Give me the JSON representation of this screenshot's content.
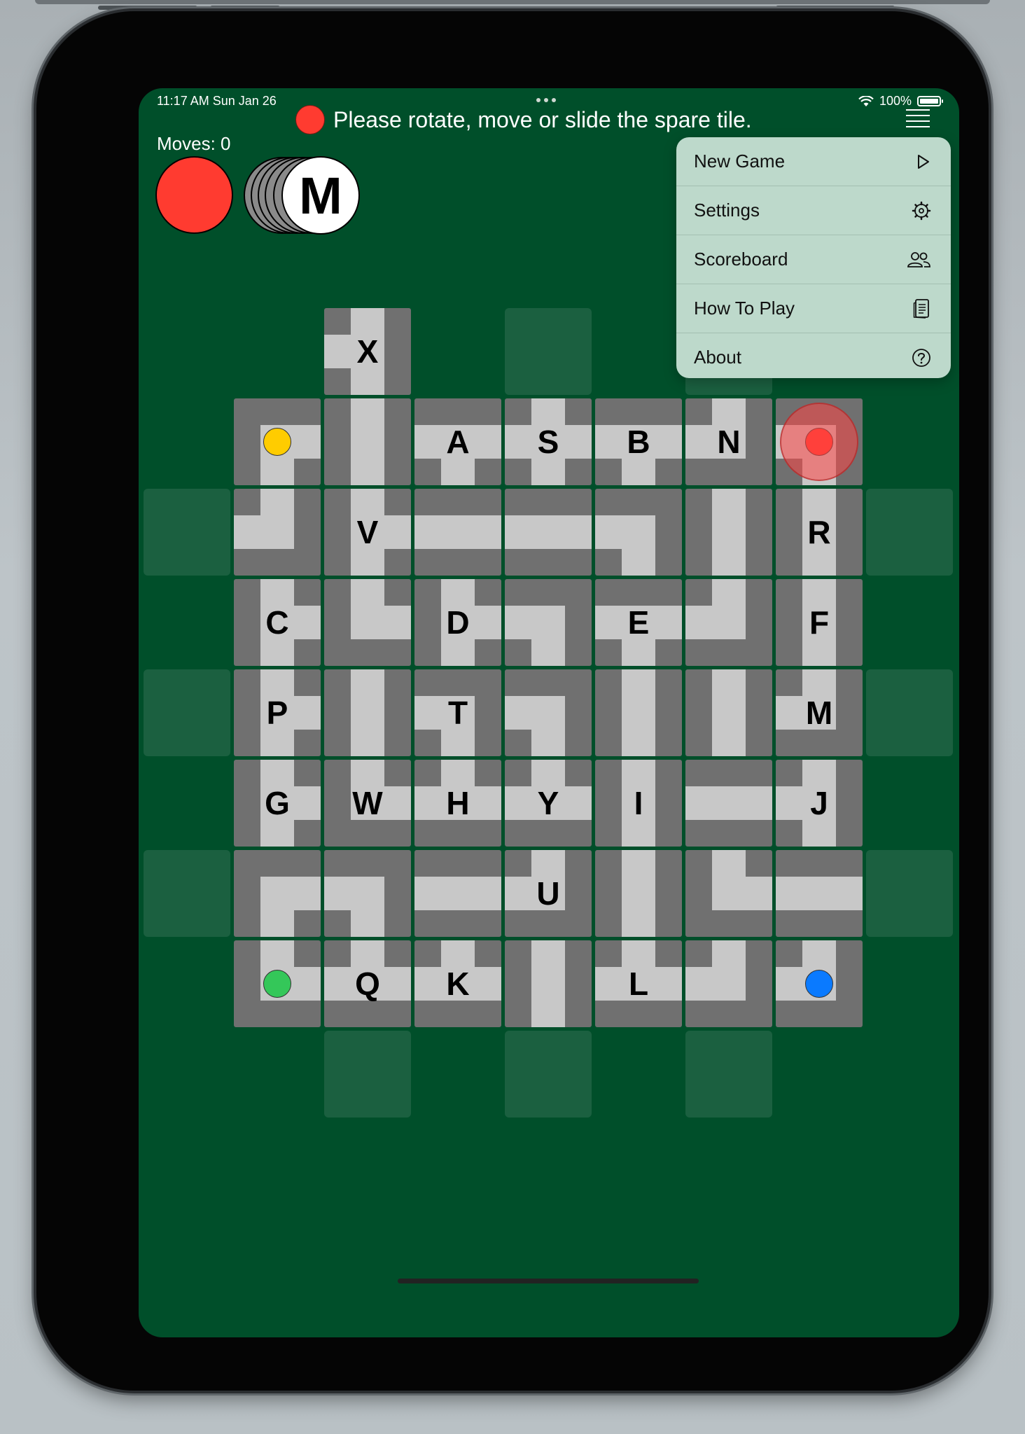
{
  "status_bar": {
    "time": "11:17 AM   Sun Jan 26",
    "battery": "100%"
  },
  "message": "Please rotate, move or slide the spare tile.",
  "moves": "Moves: 0",
  "spare_card": "M",
  "menu": {
    "items": [
      {
        "label": "New Game",
        "icon": "play-icon"
      },
      {
        "label": "Settings",
        "icon": "gear-icon"
      },
      {
        "label": "Scoreboard",
        "icon": "people-icon"
      },
      {
        "label": "How To Play",
        "icon": "document-icon"
      },
      {
        "label": "About",
        "icon": "question-icon"
      }
    ]
  },
  "colors": {
    "background": "#004f2a",
    "wall": "#707070",
    "path": "#c8c8c8",
    "red": "#ff3b30",
    "yellow": "#ffcc00",
    "green": "#34c759",
    "blue": "#0a7aff",
    "menu": "#bdd9cb"
  },
  "spare_tile": {
    "letter": "X",
    "open": "nsw"
  },
  "board": [
    [
      {
        "letter": "",
        "open": "es",
        "token": "yellow"
      },
      {
        "letter": "",
        "open": "ns"
      },
      {
        "letter": "A",
        "open": "ews"
      },
      {
        "letter": "S",
        "open": "news"
      },
      {
        "letter": "B",
        "open": "ews"
      },
      {
        "letter": "N",
        "open": "nw"
      },
      {
        "letter": "",
        "open": "ws",
        "token": "red"
      }
    ],
    [
      {
        "letter": "",
        "open": "nw"
      },
      {
        "letter": "V",
        "open": "nes"
      },
      {
        "letter": "",
        "open": "ew"
      },
      {
        "letter": "",
        "open": "ew"
      },
      {
        "letter": "",
        "open": "ws"
      },
      {
        "letter": "",
        "open": "ns"
      },
      {
        "letter": "R",
        "open": "ns"
      }
    ],
    [
      {
        "letter": "C",
        "open": "nes"
      },
      {
        "letter": "",
        "open": "ne"
      },
      {
        "letter": "D",
        "open": "nes"
      },
      {
        "letter": "",
        "open": "ws"
      },
      {
        "letter": "E",
        "open": "esw"
      },
      {
        "letter": "",
        "open": "nw"
      },
      {
        "letter": "F",
        "open": "ns"
      }
    ],
    [
      {
        "letter": "P",
        "open": "nes"
      },
      {
        "letter": "",
        "open": "ns"
      },
      {
        "letter": "T",
        "open": "sw"
      },
      {
        "letter": "",
        "open": "ws"
      },
      {
        "letter": "",
        "open": "ns"
      },
      {
        "letter": "",
        "open": "ns"
      },
      {
        "letter": "M",
        "open": "nw"
      }
    ],
    [
      {
        "letter": "G",
        "open": "nes"
      },
      {
        "letter": "W",
        "open": "ne"
      },
      {
        "letter": "H",
        "open": "new"
      },
      {
        "letter": "Y",
        "open": "new"
      },
      {
        "letter": "I",
        "open": "ns"
      },
      {
        "letter": "",
        "open": "ew"
      },
      {
        "letter": "J",
        "open": "nsw"
      }
    ],
    [
      {
        "letter": "",
        "open": "es"
      },
      {
        "letter": "",
        "open": "ws"
      },
      {
        "letter": "",
        "open": "ew"
      },
      {
        "letter": "U",
        "open": "nw"
      },
      {
        "letter": "",
        "open": "ns"
      },
      {
        "letter": "",
        "open": "ne"
      },
      {
        "letter": "",
        "open": "ew"
      }
    ],
    [
      {
        "letter": "",
        "open": "ne",
        "token": "green"
      },
      {
        "letter": "Q",
        "open": "new"
      },
      {
        "letter": "K",
        "open": "new"
      },
      {
        "letter": "",
        "open": "ns"
      },
      {
        "letter": "L",
        "open": "new"
      },
      {
        "letter": "",
        "open": "nw"
      },
      {
        "letter": "",
        "open": "nw",
        "token": "blue"
      }
    ]
  ]
}
